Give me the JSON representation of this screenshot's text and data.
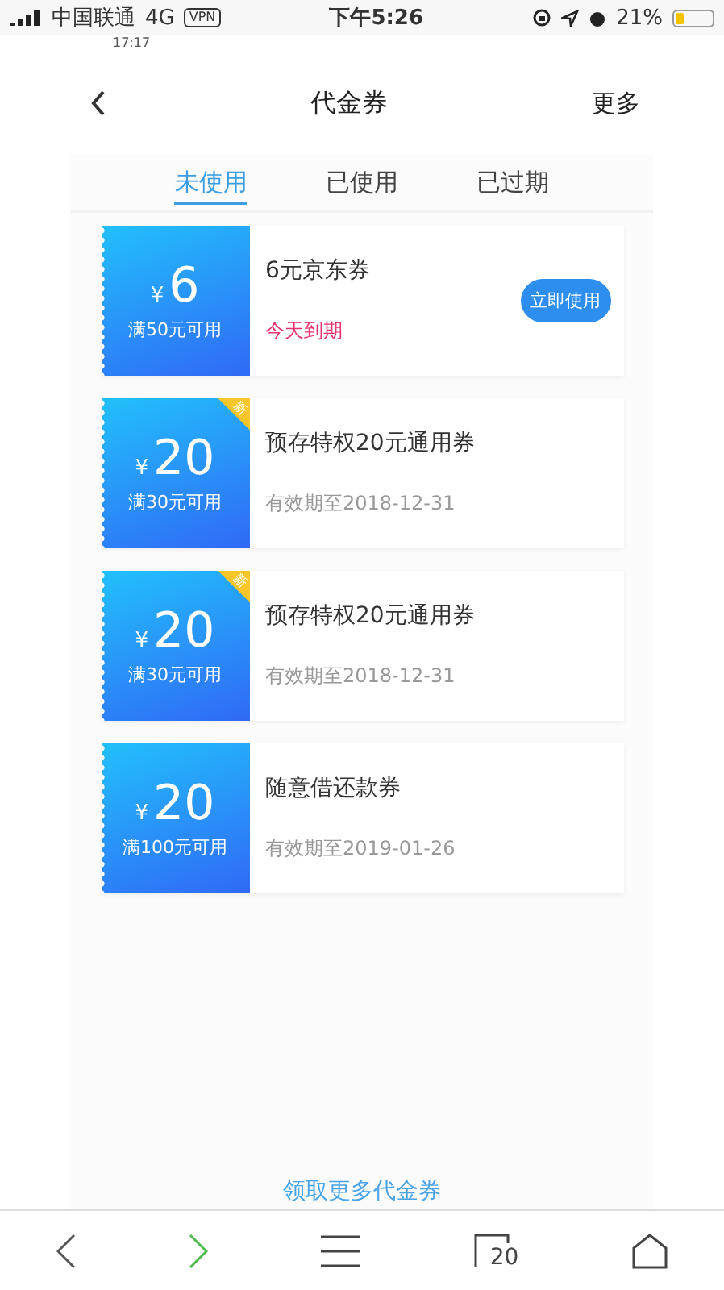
{
  "status_bar": {
    "carrier": "中国联通",
    "network": "4G",
    "vpn": "VPN",
    "time": "下午5:26",
    "battery_text": "21%",
    "battery": {
      "level": 0.21
    }
  },
  "inner_status": {
    "time": "17:17"
  },
  "header": {
    "title": "代金券",
    "action": "更多"
  },
  "tabs": [
    {
      "label": "未使用",
      "selected": true
    },
    {
      "label": "已使用",
      "selected": false
    },
    {
      "label": "已过期",
      "selected": false
    }
  ],
  "coupons": [
    {
      "currency": "¥",
      "amount": "6",
      "condition": "满50元可用",
      "title": "6元京东券",
      "note": "今天到期",
      "expiring": true,
      "button": "立即使用"
    },
    {
      "currency": "¥",
      "amount": "20",
      "condition": "满30元可用",
      "title": "预存特权20元通用券",
      "note": "有效期至2018-12-31",
      "expiring": false,
      "badge": "新"
    },
    {
      "currency": "¥",
      "amount": "20",
      "condition": "满30元可用",
      "title": "预存特权20元通用券",
      "note": "有效期至2018-12-31",
      "expiring": false,
      "badge": "新"
    },
    {
      "currency": "¥",
      "amount": "20",
      "condition": "满100元可用",
      "title": "随意借还款券",
      "note": "有效期至2019-01-26",
      "expiring": false
    }
  ],
  "more_link": "领取更多代金券",
  "browser_bar": {
    "tab_count": "20"
  }
}
